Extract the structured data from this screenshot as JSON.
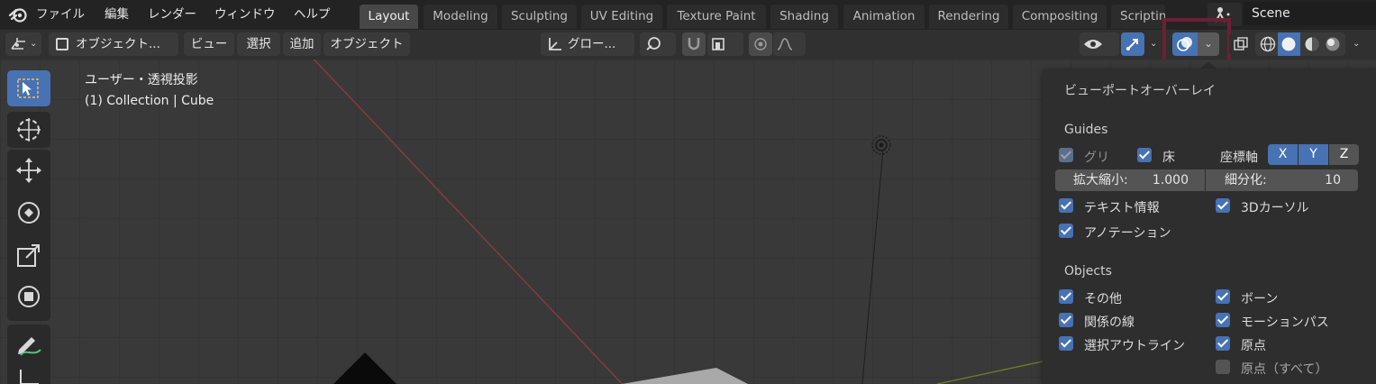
{
  "menubar": {
    "items": [
      "ファイル",
      "編集",
      "レンダー",
      "ウィンドウ",
      "ヘルプ"
    ]
  },
  "workspaces": {
    "tabs": [
      "Layout",
      "Modeling",
      "Sculpting",
      "UV Editing",
      "Texture Paint",
      "Shading",
      "Animation",
      "Rendering",
      "Compositing",
      "Scripting"
    ],
    "active": "Layout"
  },
  "scene": {
    "name": "Scene"
  },
  "header": {
    "mode": "オブジェクト...",
    "view": "ビュー",
    "select": "選択",
    "add": "追加",
    "object": "オブジェクト",
    "transform_orientation": "グロー..."
  },
  "viewport": {
    "view_name": "ユーザー・透視投影",
    "collection_info": "(1) Collection | Cube"
  },
  "overlay_panel": {
    "title": "ビューポートオーバーレイ",
    "guides": {
      "section_label": "Guides",
      "grid_label": "グリ",
      "floor_label": "床",
      "axes_label": "座標軸",
      "axis_x": "X",
      "axis_y": "Y",
      "axis_z": "Z",
      "scale_label": "拡大縮小:",
      "scale_value": "1.000",
      "subdivisions_label": "細分化:",
      "subdivisions_value": "10",
      "text_info_label": "テキスト情報",
      "cursor_3d_label": "3Dカーソル",
      "annotations_label": "アノテーション"
    },
    "objects": {
      "section_label": "Objects",
      "extras_label": "その他",
      "bones_label": "ボーン",
      "relationship_lines_label": "関係の線",
      "motion_paths_label": "モーションパス",
      "outline_selected_label": "選択アウトライン",
      "origins_label": "原点",
      "origins_all_label": "原点（すべて）"
    }
  },
  "highlight_color": "#6e1f35",
  "accent_color": "#4772b3"
}
